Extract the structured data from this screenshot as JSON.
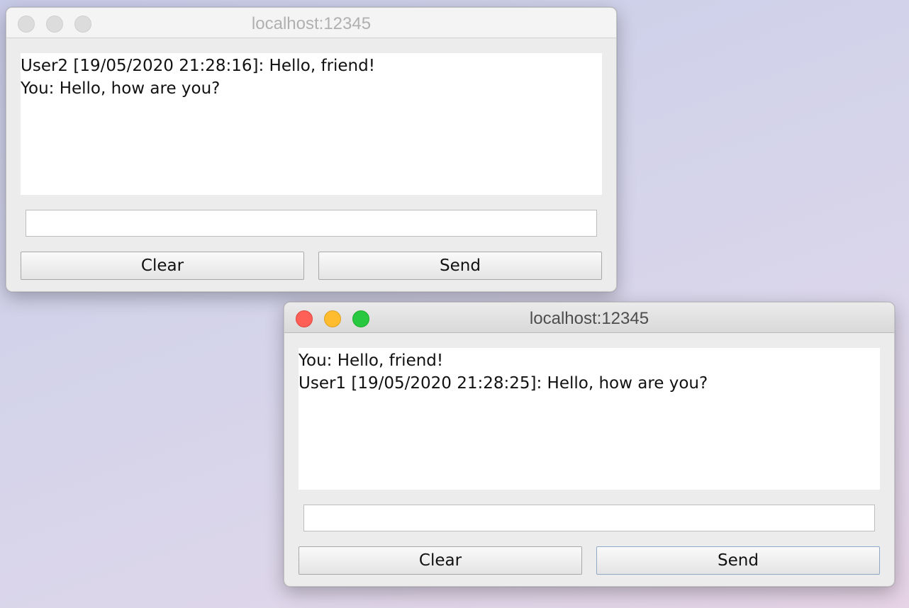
{
  "windows": [
    {
      "title": "localhost:12345",
      "active": false,
      "messages": [
        "User2 [19/05/2020 21:28:16]: Hello, friend!",
        "You: Hello, how are you?"
      ],
      "input_value": "",
      "clear_label": "Clear",
      "send_label": "Send"
    },
    {
      "title": "localhost:12345",
      "active": true,
      "messages": [
        "You: Hello, friend!",
        "User1 [19/05/2020 21:28:25]: Hello, how are you?"
      ],
      "input_value": "",
      "clear_label": "Clear",
      "send_label": "Send"
    }
  ],
  "colors": {
    "close": "#fe5f57",
    "minimize": "#febc2e",
    "zoom": "#28c840",
    "inactive_light": "#dcdcdc",
    "window_bg": "#ececec"
  }
}
